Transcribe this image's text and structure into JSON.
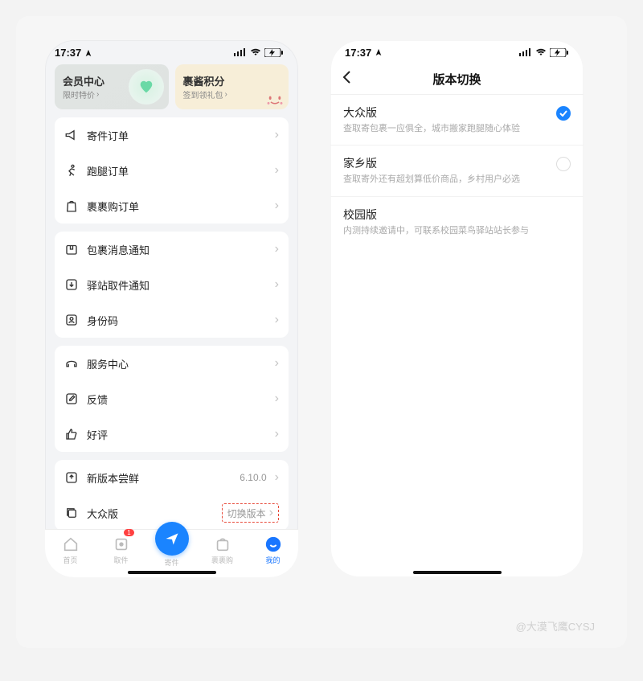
{
  "status": {
    "time": "17:37"
  },
  "left": {
    "cards": {
      "member": {
        "title": "会员中心",
        "sub": "限时特价"
      },
      "points": {
        "title": "裹酱积分",
        "sub": "签到领礼包"
      }
    },
    "group1": [
      {
        "label": "寄件订单"
      },
      {
        "label": "跑腿订单"
      },
      {
        "label": "裹裹购订单"
      }
    ],
    "group2": [
      {
        "label": "包裹消息通知"
      },
      {
        "label": "驿站取件通知"
      },
      {
        "label": "身份码"
      }
    ],
    "group3": [
      {
        "label": "服务中心"
      },
      {
        "label": "反馈"
      },
      {
        "label": "好评"
      }
    ],
    "group4": {
      "new_version_label": "新版本尝鲜",
      "new_version_value": "6.10.0",
      "current_version_label": "大众版",
      "switch_label": "切换版本"
    },
    "tabs": {
      "home": "首页",
      "pickup": "取件",
      "send": "寄件",
      "shop": "裹裹购",
      "mine": "我的",
      "badge": "1"
    }
  },
  "right": {
    "title": "版本切换",
    "options": [
      {
        "title": "大众版",
        "sub": "查取寄包裹一应俱全，城市搬家跑腿随心体验",
        "checked": true
      },
      {
        "title": "家乡版",
        "sub": "查取寄外还有超划算低价商品，乡村用户必选",
        "checked": false
      },
      {
        "title": "校园版",
        "sub": "内测持续邀请中，可联系校园菜鸟驿站站长参与",
        "checked": null
      }
    ]
  },
  "watermark": "@大漠飞鹰CYSJ"
}
